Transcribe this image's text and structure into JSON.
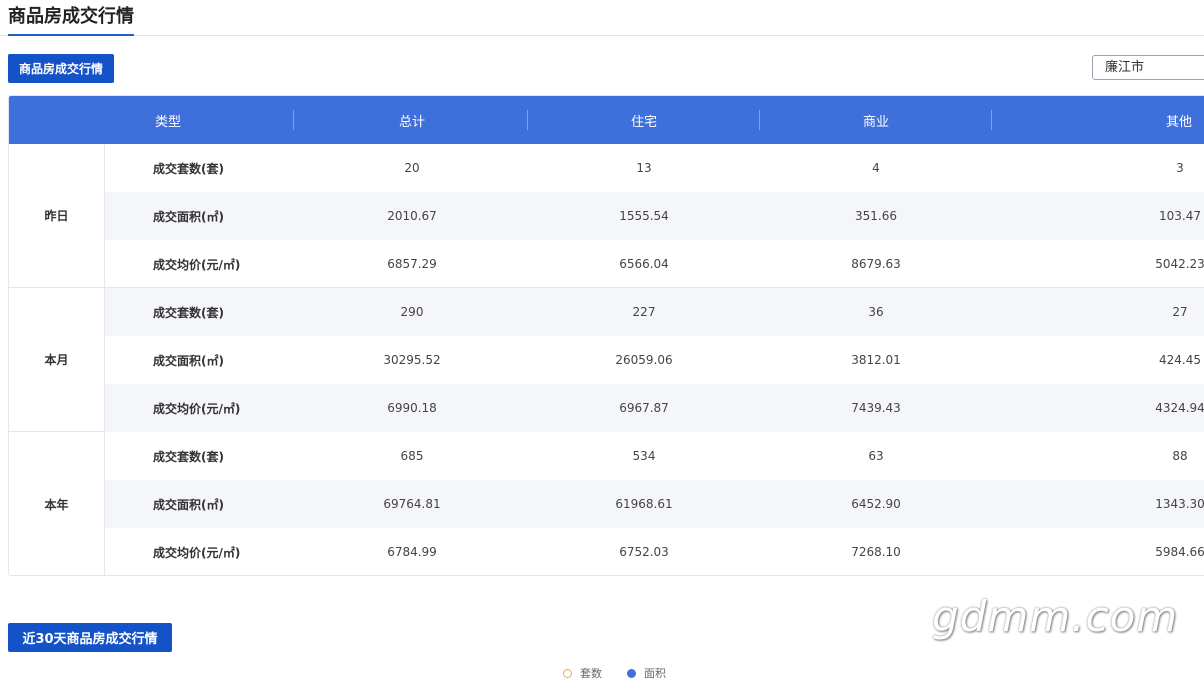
{
  "page": {
    "title": "商品房成交行情"
  },
  "section1": {
    "button_label": "商品房成交行情"
  },
  "city_select": {
    "value": "廉江市"
  },
  "table": {
    "headers": [
      "类型",
      "总计",
      "住宅",
      "商业",
      "其他"
    ],
    "groups": [
      {
        "period": "昨日",
        "rows": [
          {
            "metric": "成交套数(套)",
            "total": "20",
            "residential": "13",
            "commercial": "4",
            "other": "3"
          },
          {
            "metric": "成交面积(㎡)",
            "total": "2010.67",
            "residential": "1555.54",
            "commercial": "351.66",
            "other": "103.47"
          },
          {
            "metric": "成交均价(元/㎡)",
            "total": "6857.29",
            "residential": "6566.04",
            "commercial": "8679.63",
            "other": "5042.23"
          }
        ]
      },
      {
        "period": "本月",
        "rows": [
          {
            "metric": "成交套数(套)",
            "total": "290",
            "residential": "227",
            "commercial": "36",
            "other": "27"
          },
          {
            "metric": "成交面积(㎡)",
            "total": "30295.52",
            "residential": "26059.06",
            "commercial": "3812.01",
            "other": "424.45"
          },
          {
            "metric": "成交均价(元/㎡)",
            "total": "6990.18",
            "residential": "6967.87",
            "commercial": "7439.43",
            "other": "4324.94"
          }
        ]
      },
      {
        "period": "本年",
        "rows": [
          {
            "metric": "成交套数(套)",
            "total": "685",
            "residential": "534",
            "commercial": "63",
            "other": "88"
          },
          {
            "metric": "成交面积(㎡)",
            "total": "69764.81",
            "residential": "61968.61",
            "commercial": "6452.90",
            "other": "1343.30"
          },
          {
            "metric": "成交均价(元/㎡)",
            "total": "6784.99",
            "residential": "6752.03",
            "commercial": "7268.10",
            "other": "5984.66"
          }
        ]
      }
    ]
  },
  "section2": {
    "button_label": "近30天商品房成交行情"
  },
  "legend": {
    "count_label": "套数",
    "area_label": "面积"
  },
  "watermark": "gdmm.com",
  "colors": {
    "header_bg": "#3e6fdb",
    "button_bg": "#1453c7",
    "alt_row": "#f5f6fa",
    "count_marker": "#f0a94a"
  }
}
